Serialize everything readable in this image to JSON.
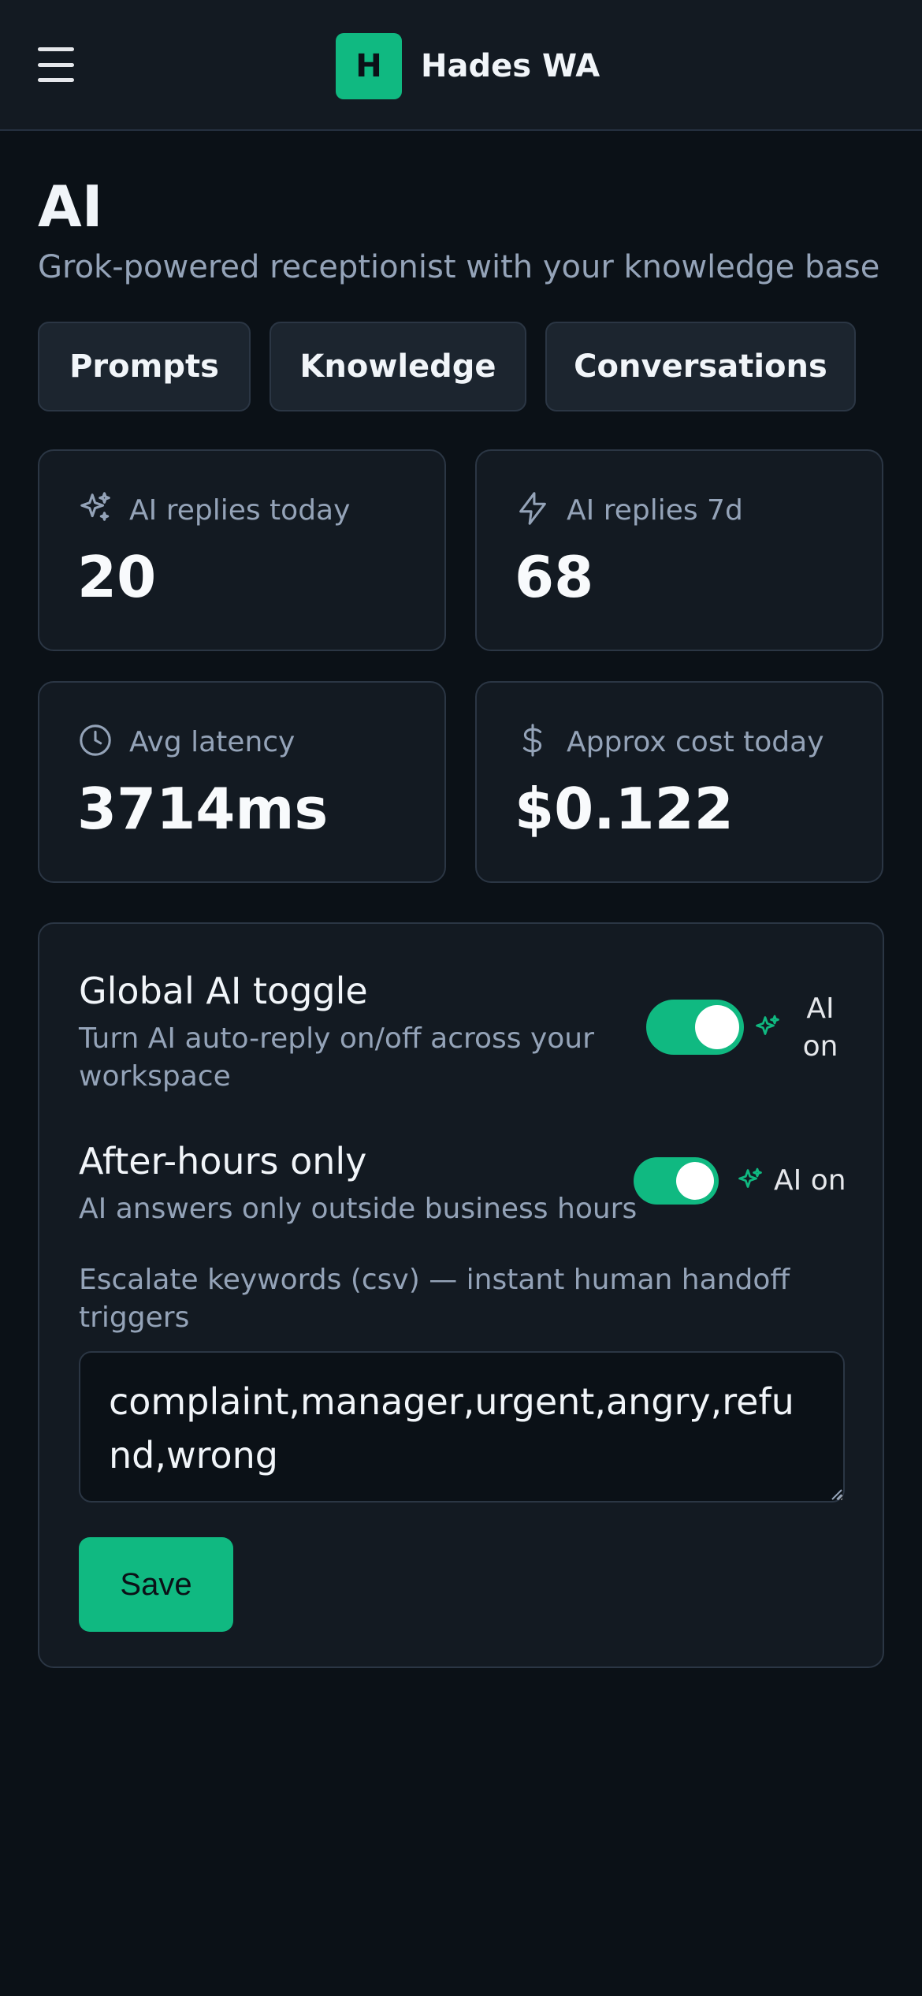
{
  "header": {
    "brand_letter": "H",
    "brand_name": "Hades WA",
    "menu_icon": "hamburger-menu-icon"
  },
  "page": {
    "title": "AI",
    "subtitle": "Grok-powered receptionist with your knowledge base"
  },
  "tabs": [
    {
      "label": "Prompts"
    },
    {
      "label": "Knowledge"
    },
    {
      "label": "Conversations"
    }
  ],
  "stats": [
    {
      "label": "AI replies today",
      "value": "20",
      "icon": "sparkles-icon"
    },
    {
      "label": "AI replies 7d",
      "value": "68",
      "icon": "lightning-icon"
    },
    {
      "label": "Avg latency",
      "value": "3714ms",
      "icon": "clock-icon"
    },
    {
      "label": "Approx cost today",
      "value": "$0.122",
      "icon": "dollar-icon"
    }
  ],
  "settings": {
    "global_toggle": {
      "title": "Global AI toggle",
      "description": "Turn AI auto-reply on/off across your workspace",
      "enabled": true,
      "status_label": "AI on"
    },
    "after_hours": {
      "title": "After-hours only",
      "description": "AI answers only outside business hours",
      "enabled": true,
      "status_label": "AI on"
    },
    "escalate": {
      "label": "Escalate keywords (csv) — instant human handoff triggers",
      "value": "complaint,manager,urgent,angry,refund,wrong"
    },
    "save_label": "Save"
  },
  "colors": {
    "accent": "#10b981",
    "background": "#0b1117",
    "card": "#131a22",
    "muted_text": "#94a3b8"
  }
}
